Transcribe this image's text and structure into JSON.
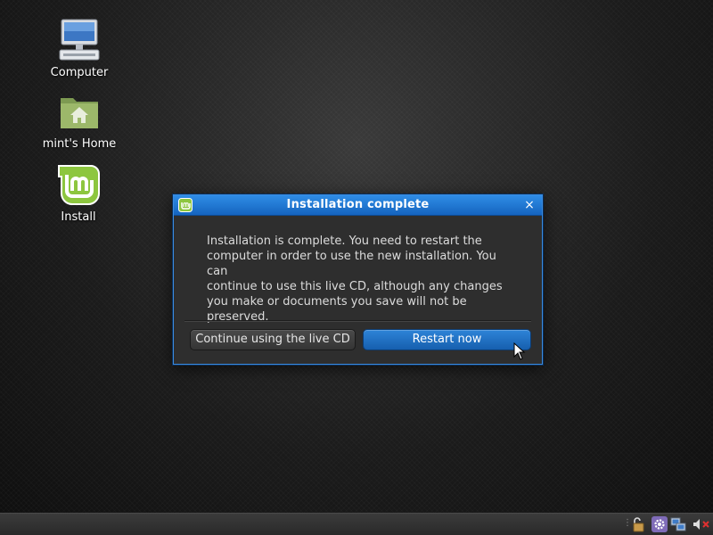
{
  "desktop": {
    "icons": [
      {
        "label": "Computer",
        "icon": "computer-icon"
      },
      {
        "label": "mint's Home",
        "icon": "home-folder-icon"
      },
      {
        "label": "Install",
        "icon": "mint-install-icon"
      }
    ]
  },
  "dialog": {
    "title": "Installation complete",
    "title_icon": "mint-logo-icon",
    "close_label": "×",
    "message": "Installation is complete. You need to restart the\ncomputer in order to use the new installation. You can\ncontinue to use this live CD, although any changes\nyou make or documents you save will not be\npreserved.",
    "buttons": {
      "continue_label": "Continue using the live CD",
      "restart_label": "Restart now"
    }
  },
  "panel": {
    "tray_icons": [
      "lock-icon",
      "settings-gear-icon",
      "network-icon",
      "volume-muted-icon"
    ]
  },
  "colors": {
    "accent": "#1f74d0",
    "dialog_bg": "#2e2e2e",
    "panel_bg": "#333333",
    "mint_green": "#8dc63f"
  }
}
